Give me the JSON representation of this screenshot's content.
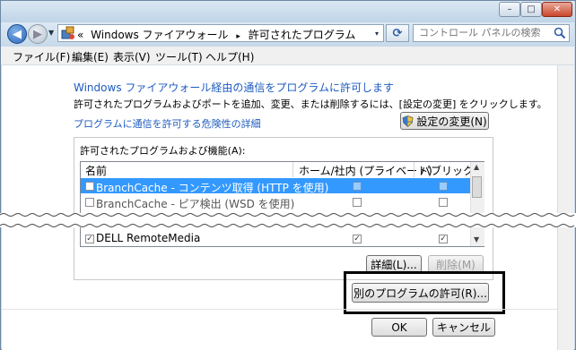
{
  "window": {
    "minimize_glyph": "–",
    "maximize_glyph": "□",
    "close_glyph": "✕"
  },
  "address": {
    "prefix": "«",
    "crumb1": "Windows ファイアウォール",
    "separator": "▸",
    "crumb2": "許可されたプログラム",
    "dropdown_glyph": "▾"
  },
  "search": {
    "placeholder": "コントロール パネルの検索",
    "icon": "search-icon"
  },
  "menu": [
    "ファイル(F)",
    "編集(E)",
    "表示(V)",
    "ツール(T)",
    "ヘルプ(H)"
  ],
  "content": {
    "heading": "Windows ファイアウォール経由の通信をプログラムに許可します",
    "instruction": "許可されたプログラムおよびポートを追加、変更、または削除するには、[設定の変更] をクリックします。",
    "risk_link": "プログラムに通信を許可する危険性の詳細",
    "change_settings_label": "設定の変更(N)",
    "group_label": "許可されたプログラムおよび機能(A):",
    "columns": [
      "名前",
      "ホーム/社内 (プライベート)",
      "パブリック"
    ],
    "rows": [
      {
        "name": "BranchCache - コンテンツ取得 (HTTP を使用)",
        "checked": false,
        "home": false,
        "public": false,
        "selected": true
      },
      {
        "name": "BranchCache - ピア検出 (WSD を使用)",
        "checked": false,
        "home": false,
        "public": false,
        "selected": false
      },
      {
        "name": "DELL RemoteMedia",
        "checked": true,
        "home": true,
        "public": true,
        "selected": false
      }
    ],
    "details_label": "詳細(L)...",
    "remove_label": "削除(M)",
    "allow_other_label": "別のプログラムの許可(R)...",
    "ok_label": "OK",
    "cancel_label": "キャンセル"
  },
  "colors": {
    "selection": "#3399ff",
    "link": "#1e5bbf",
    "frame": "#c9dbea"
  }
}
